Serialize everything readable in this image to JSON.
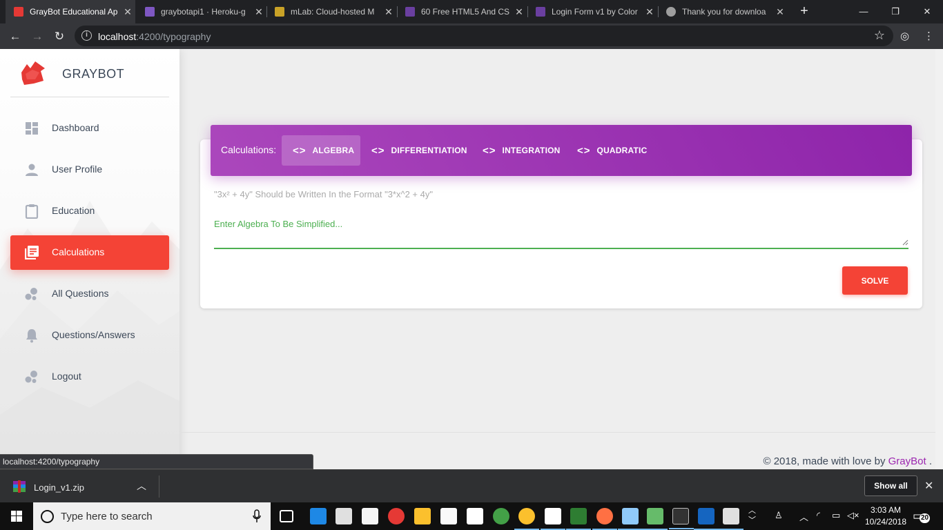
{
  "browser": {
    "tabs": [
      {
        "title": "GrayBot Educational Ap",
        "color": "#e53935"
      },
      {
        "title": "graybotapi1 · Heroku-g",
        "color": "#7e57c2"
      },
      {
        "title": "mLab: Cloud-hosted M",
        "color": "#c9a227"
      },
      {
        "title": "60 Free HTML5 And CS",
        "color": "#6a3fa0"
      },
      {
        "title": "Login Form v1 by Color",
        "color": "#6a3fa0"
      },
      {
        "title": "Thank you for downloa",
        "color": "#9e9e9e"
      }
    ],
    "url_host": "localhost",
    "url_path": ":4200/typography"
  },
  "sidebar": {
    "brand": "GRAYBOT",
    "items": [
      {
        "label": "Dashboard",
        "icon": "dashboard-icon"
      },
      {
        "label": "User Profile",
        "icon": "person-icon"
      },
      {
        "label": "Education",
        "icon": "clipboard-icon"
      },
      {
        "label": "Calculations",
        "icon": "library-books-icon",
        "active": true
      },
      {
        "label": "All Questions",
        "icon": "bubble-chart-icon"
      },
      {
        "label": "Questions/Answers",
        "icon": "bell-icon"
      },
      {
        "label": "Logout",
        "icon": "bubble-chart-icon"
      }
    ]
  },
  "calc": {
    "header_title": "Calculations:",
    "tabs": [
      "ALGEBRA",
      "DIFFERENTIATION",
      "INTEGRATION",
      "QUADRATIC"
    ],
    "active_tab": "ALGEBRA",
    "hint": "\"3x² + 4y\" Should be Written In the Format \"3*x^2 + 4y\"",
    "input_placeholder": "Enter Algebra To Be Simplified...",
    "input_value": "",
    "solve_label": "SOLVE"
  },
  "footer": {
    "prefix": "© 2018, made with love by ",
    "link": "GrayBot",
    "suffix": " ."
  },
  "status_url": "localhost:4200/typography",
  "download": {
    "filename": "Login_v1.zip",
    "show_all": "Show all"
  },
  "taskbar": {
    "search_placeholder": "Type here to search",
    "time": "3:03 AM",
    "date": "10/24/2018",
    "notifications": "20"
  },
  "colors": {
    "accent_purple": "#9c27b0",
    "accent_red": "#f44336",
    "input_green": "#4caf50"
  }
}
